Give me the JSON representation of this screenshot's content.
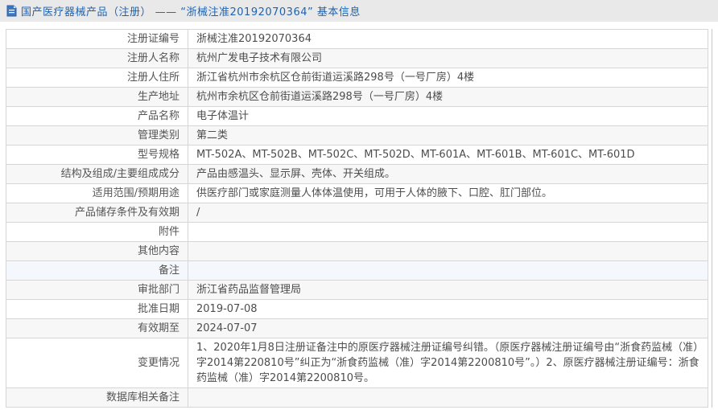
{
  "header": {
    "icon": "document-icon",
    "title": "国产医疗器械产品（注册） —— “浙械注准20192070364” 基本信息"
  },
  "colors": {
    "accent_blue": "#1e63b0",
    "header_bg": "#e9e9e9",
    "stripe_bg": "#f7f7f7",
    "note_row_bg": "#f4f7fc",
    "border": "#c9c9c9",
    "text": "#4d4d4d"
  },
  "table": {
    "rows": [
      {
        "label": "注册证编号",
        "value": "浙械注准20192070364"
      },
      {
        "label": "注册人名称",
        "value": "杭州广发电子技术有限公司"
      },
      {
        "label": "注册人住所",
        "value": "浙江省杭州市余杭区仓前街道运溪路298号（一号厂房）4楼"
      },
      {
        "label": "生产地址",
        "value": "杭州市余杭区仓前街道运溪路298号（一号厂房）4楼"
      },
      {
        "label": "产品名称",
        "value": "电子体温计"
      },
      {
        "label": "管理类别",
        "value": "第二类"
      },
      {
        "label": "型号规格",
        "value": "MT-502A、MT-502B、MT-502C、MT-502D、MT-601A、MT-601B、MT-601C、MT-601D"
      },
      {
        "label": "结构及组成/主要组成成分",
        "value": "产品由感温头、显示屏、壳体、开关组成。"
      },
      {
        "label": "适用范围/预期用途",
        "value": "供医疗部门或家庭测量人体体温使用，可用于人体的腋下、口腔、肛门部位。"
      },
      {
        "label": "产品储存条件及有效期",
        "value": "/"
      },
      {
        "label": "附件",
        "value": ""
      },
      {
        "label": "其他内容",
        "value": ""
      },
      {
        "label": "备注",
        "value": ""
      },
      {
        "label": "审批部门",
        "value": "浙江省药品监督管理局"
      },
      {
        "label": "批准日期",
        "value": "2019-07-08"
      },
      {
        "label": "有效期至",
        "value": "2024-07-07"
      },
      {
        "label": "变更情况",
        "value": "1、2020年1月8日注册证备注中的原医疗器械注册证编号纠错。（原医疗器械注册证编号由“浙食药监械（准）字2014第220810号”纠正为“浙食药监械（准）字2014第2200810号”。）2、原医疗器械注册证编号：浙食药监械（准）字2014第2200810号。"
      },
      {
        "label": "数据库相关备注",
        "value": ""
      }
    ]
  }
}
